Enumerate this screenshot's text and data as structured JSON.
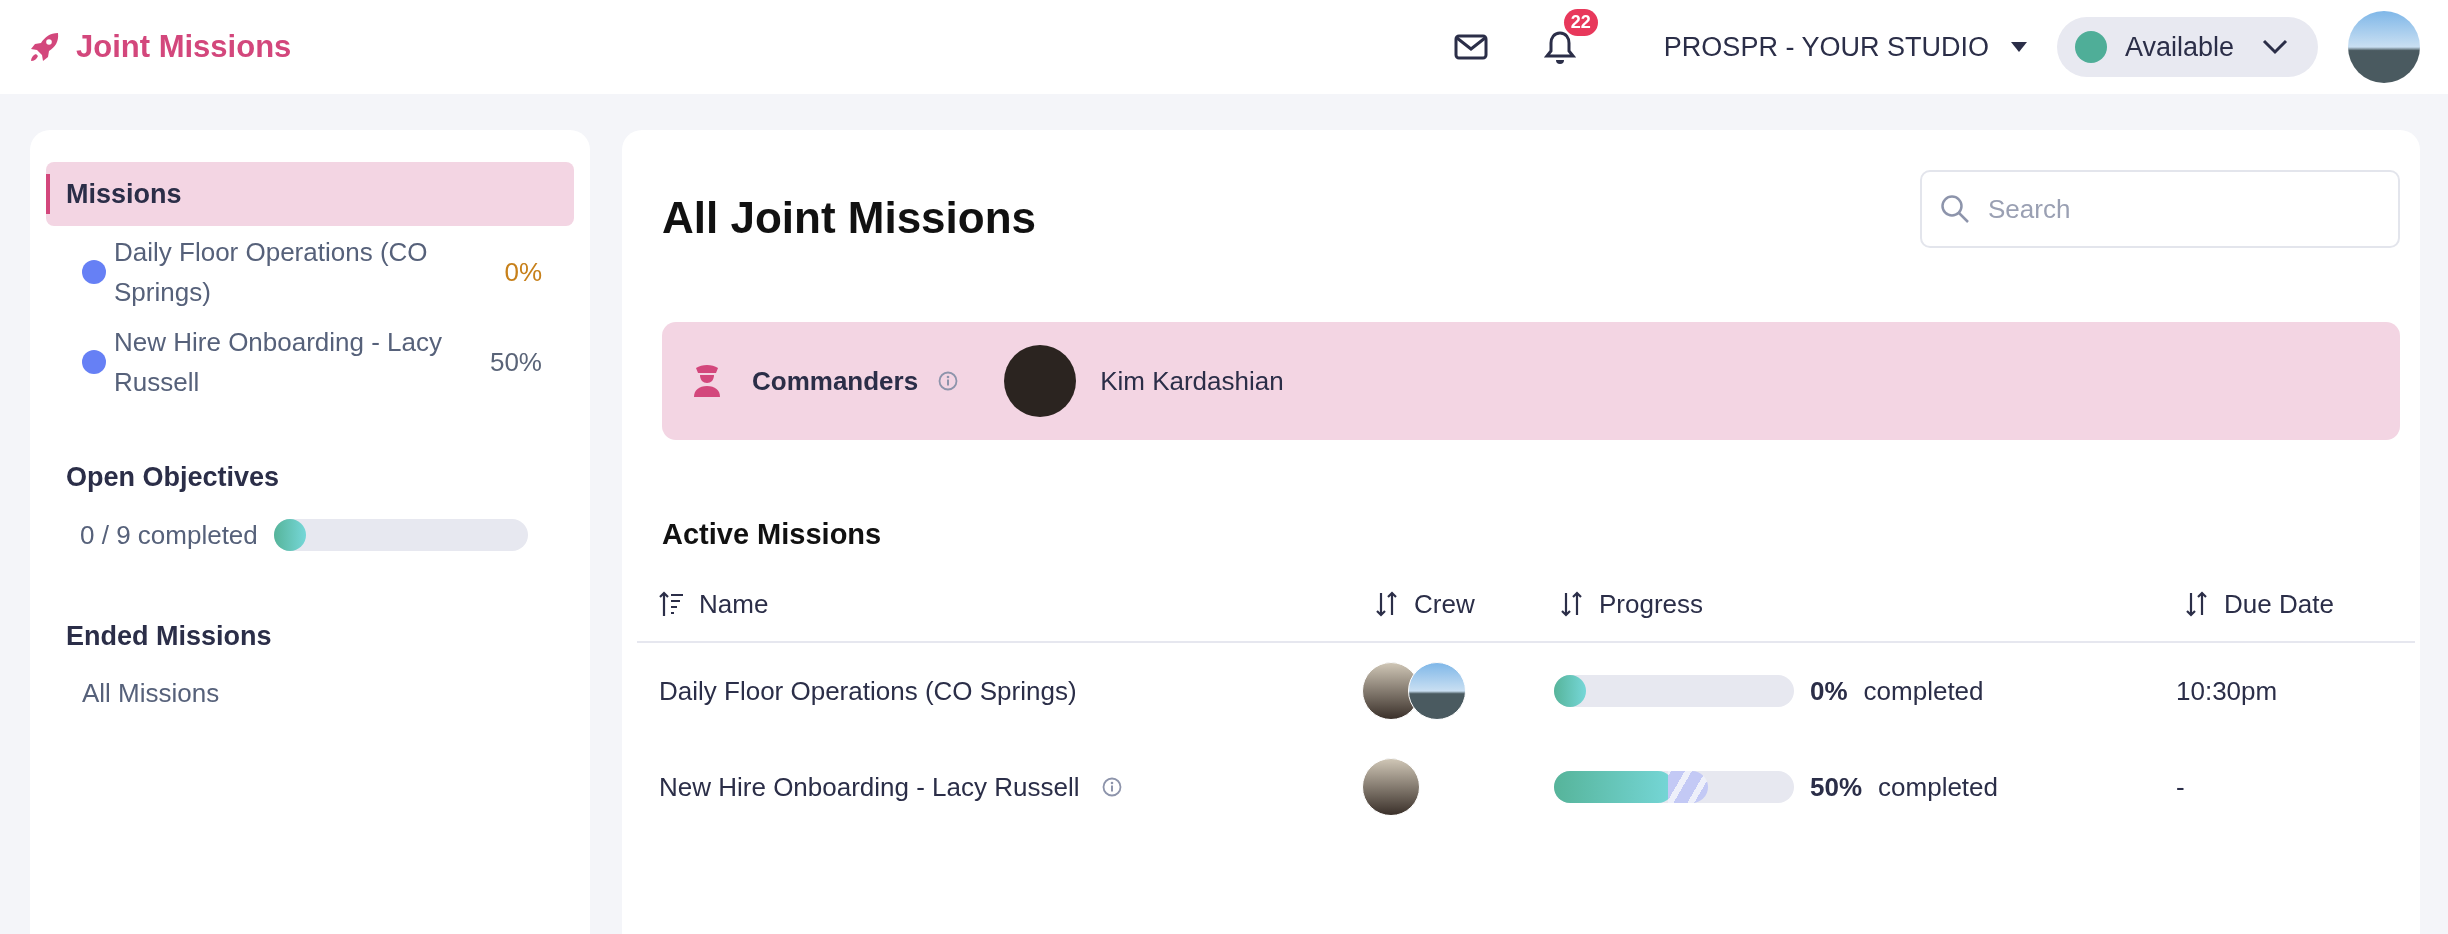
{
  "app": {
    "title": "Joint Missions"
  },
  "header": {
    "notifications": "22",
    "studio": "PROSPR - YOUR STUDIO",
    "status": {
      "label": "Available",
      "color": "#4fae98"
    }
  },
  "sidebar": {
    "missions_heading": {
      "label": "Missions",
      "selected": true
    },
    "missions": [
      {
        "name": "Daily Floor Operations (CO Springs)",
        "percent": "0%",
        "color": "#c7801a"
      },
      {
        "name": "New Hire Onboarding - Lacy Russell",
        "percent": "50%",
        "color": "#5a6478"
      }
    ],
    "objectives": {
      "heading": "Open Objectives",
      "reading": "0 / 9 completed",
      "level": 0
    },
    "ended": {
      "heading": "Ended Missions",
      "link": "All Missions"
    }
  },
  "main": {
    "title": "All Joint Missions",
    "search": {
      "placeholder": "Search"
    },
    "commanders": {
      "label": "Commanders",
      "names": [
        "Kim Kardashian"
      ]
    },
    "active": {
      "heading": "Active Missions",
      "columns": [
        {
          "label": "Name",
          "sorted": true
        },
        {
          "label": "Crew",
          "sorted": false
        },
        {
          "label": "Progress",
          "sorted": false
        },
        {
          "label": "Due Date",
          "sorted": false
        }
      ],
      "rows": [
        {
          "name": "Daily Floor Operations (CO Springs)",
          "info": false,
          "crew": [
            {
              "kind": "avatar"
            },
            {
              "kind": "avatar"
            }
          ],
          "level": 0,
          "percent": "0%",
          "suffix": "completed",
          "due": "10:30pm"
        },
        {
          "name": "New Hire Onboarding - Lacy Russell",
          "info": true,
          "crew": [
            {
              "kind": "avatar"
            }
          ],
          "level": 0.5,
          "percent": "50%",
          "suffix": "completed",
          "due": "-"
        }
      ]
    }
  }
}
